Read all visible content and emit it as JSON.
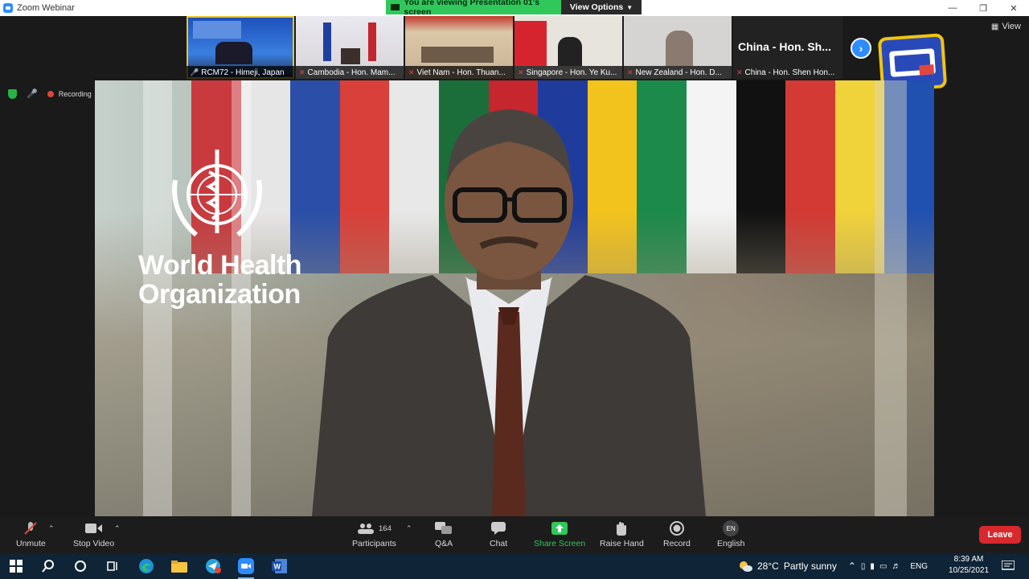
{
  "window": {
    "title": "Zoom Webinar"
  },
  "banner": {
    "viewing_text": "You are viewing Presentation 01's screen",
    "view_options_label": "View Options"
  },
  "thumbnails": [
    {
      "label": "RCM72 - Himeji, Japan",
      "muted": false,
      "active": true
    },
    {
      "label": "Cambodia - Hon. Mam...",
      "muted": true,
      "active": false
    },
    {
      "label": "Viet Nam - Hon. Thuan...",
      "muted": true,
      "active": false
    },
    {
      "label": "Singapore - Hon. Ye Ku...",
      "muted": true,
      "active": false
    },
    {
      "label": "New Zealand - Hon. D...",
      "muted": true,
      "active": false
    }
  ],
  "china_tile": {
    "name": "China - Hon. Sh...",
    "label": "China - Hon. Shen Hon..."
  },
  "view_button": {
    "label": "View"
  },
  "status": {
    "recording_label": "Recording"
  },
  "video": {
    "org_name_line1": "World Health",
    "org_name_line2": "Organization"
  },
  "toolbar": {
    "unmute": "Unmute",
    "stop_video": "Stop Video",
    "participants": "Participants",
    "participants_count": "164",
    "qa": "Q&A",
    "chat": "Chat",
    "share_screen": "Share Screen",
    "raise_hand": "Raise Hand",
    "record": "Record",
    "english": "English",
    "english_badge": "EN",
    "leave": "Leave"
  },
  "taskbar": {
    "weather_temp": "28°C",
    "weather_text": "Partly sunny",
    "lang": "ENG",
    "time": "8:39 AM",
    "date": "10/25/2021"
  },
  "colors": {
    "share_green": "#30c85a",
    "zoom_blue": "#2d8cff",
    "leave_red": "#d9282d"
  }
}
